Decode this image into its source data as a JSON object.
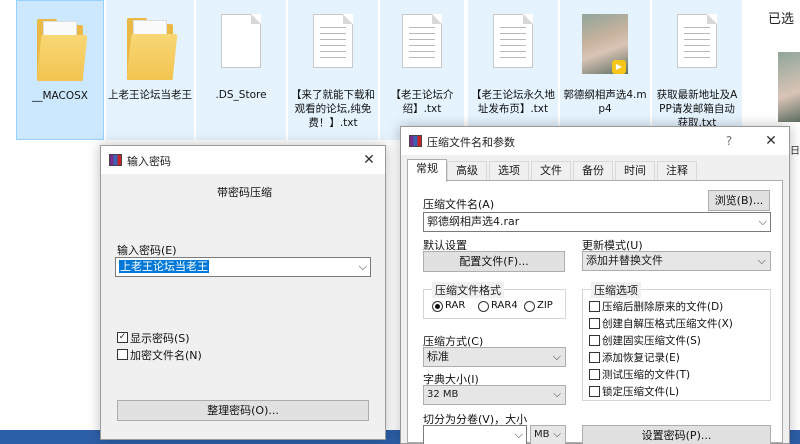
{
  "explorer": {
    "files": [
      {
        "name": "__MACOSX",
        "icon": "folder-icon"
      },
      {
        "name": "上老王论坛当老王",
        "icon": "folder-icon"
      },
      {
        "name": ".DS_Store",
        "icon": "file-icon"
      },
      {
        "name": "【来了就能下载和观看的论坛,纯免费！】.txt",
        "icon": "text-file-icon"
      },
      {
        "name": "【老王论坛介绍】.txt",
        "icon": "text-file-icon"
      },
      {
        "name": "【老王论坛永久地址发布页】.txt",
        "icon": "text-file-icon"
      },
      {
        "name": "郭德纲相声选4.mp4",
        "icon": "video-thumbnail-icon"
      },
      {
        "name": "获取最新地址及APP请发邮箱自动获取.txt",
        "icon": "text-file-icon"
      }
    ],
    "right_label": "已选",
    "right_frag": "日"
  },
  "password_dialog": {
    "title": "输入密码",
    "close": "✕",
    "heading": "带密码压缩",
    "password_label": "输入密码(E)",
    "password_value": "上老王论坛当老王",
    "show_password_label": "显示密码(S)",
    "show_password_checked": true,
    "encrypt_names_label": "加密文件名(N)",
    "encrypt_names_checked": false,
    "organize_button": "整理密码(O)..."
  },
  "archive_dialog": {
    "title": "压缩文件名和参数",
    "help": "?",
    "close": "✕",
    "tabs": [
      "常规",
      "高级",
      "选项",
      "文件",
      "备份",
      "时间",
      "注释"
    ],
    "active_tab": "常规",
    "archive_name_label": "压缩文件名(A)",
    "browse_button": "浏览(B)...",
    "archive_name_value": "郭德纲相声选4.rar",
    "default_settings_label": "默认设置",
    "profiles_button": "配置文件(F)...",
    "update_mode_label": "更新模式(U)",
    "update_mode_value": "添加并替换文件",
    "format_group": "压缩文件格式",
    "formats": [
      "RAR",
      "RAR4",
      "ZIP"
    ],
    "selected_format": "RAR",
    "method_label": "压缩方式(C)",
    "method_value": "标准",
    "dict_label": "字典大小(I)",
    "dict_value": "32 MB",
    "split_label": "切分为分卷(V)，大小",
    "split_value": "",
    "split_unit": "MB",
    "options_group": "压缩选项",
    "options": [
      {
        "label": "压缩后删除原来的文件(D)",
        "checked": false
      },
      {
        "label": "创建自解压格式压缩文件(X)",
        "checked": false
      },
      {
        "label": "创建固实压缩文件(S)",
        "checked": false
      },
      {
        "label": "添加恢复记录(E)",
        "checked": false
      },
      {
        "label": "测试压缩的文件(T)",
        "checked": false
      },
      {
        "label": "锁定压缩文件(L)",
        "checked": false
      }
    ],
    "set_password_button": "设置密码(P)..."
  },
  "colors": {
    "selection": "#cce8ff",
    "text_highlight": "#0078d7",
    "taskbar": "#2d5fa8"
  }
}
